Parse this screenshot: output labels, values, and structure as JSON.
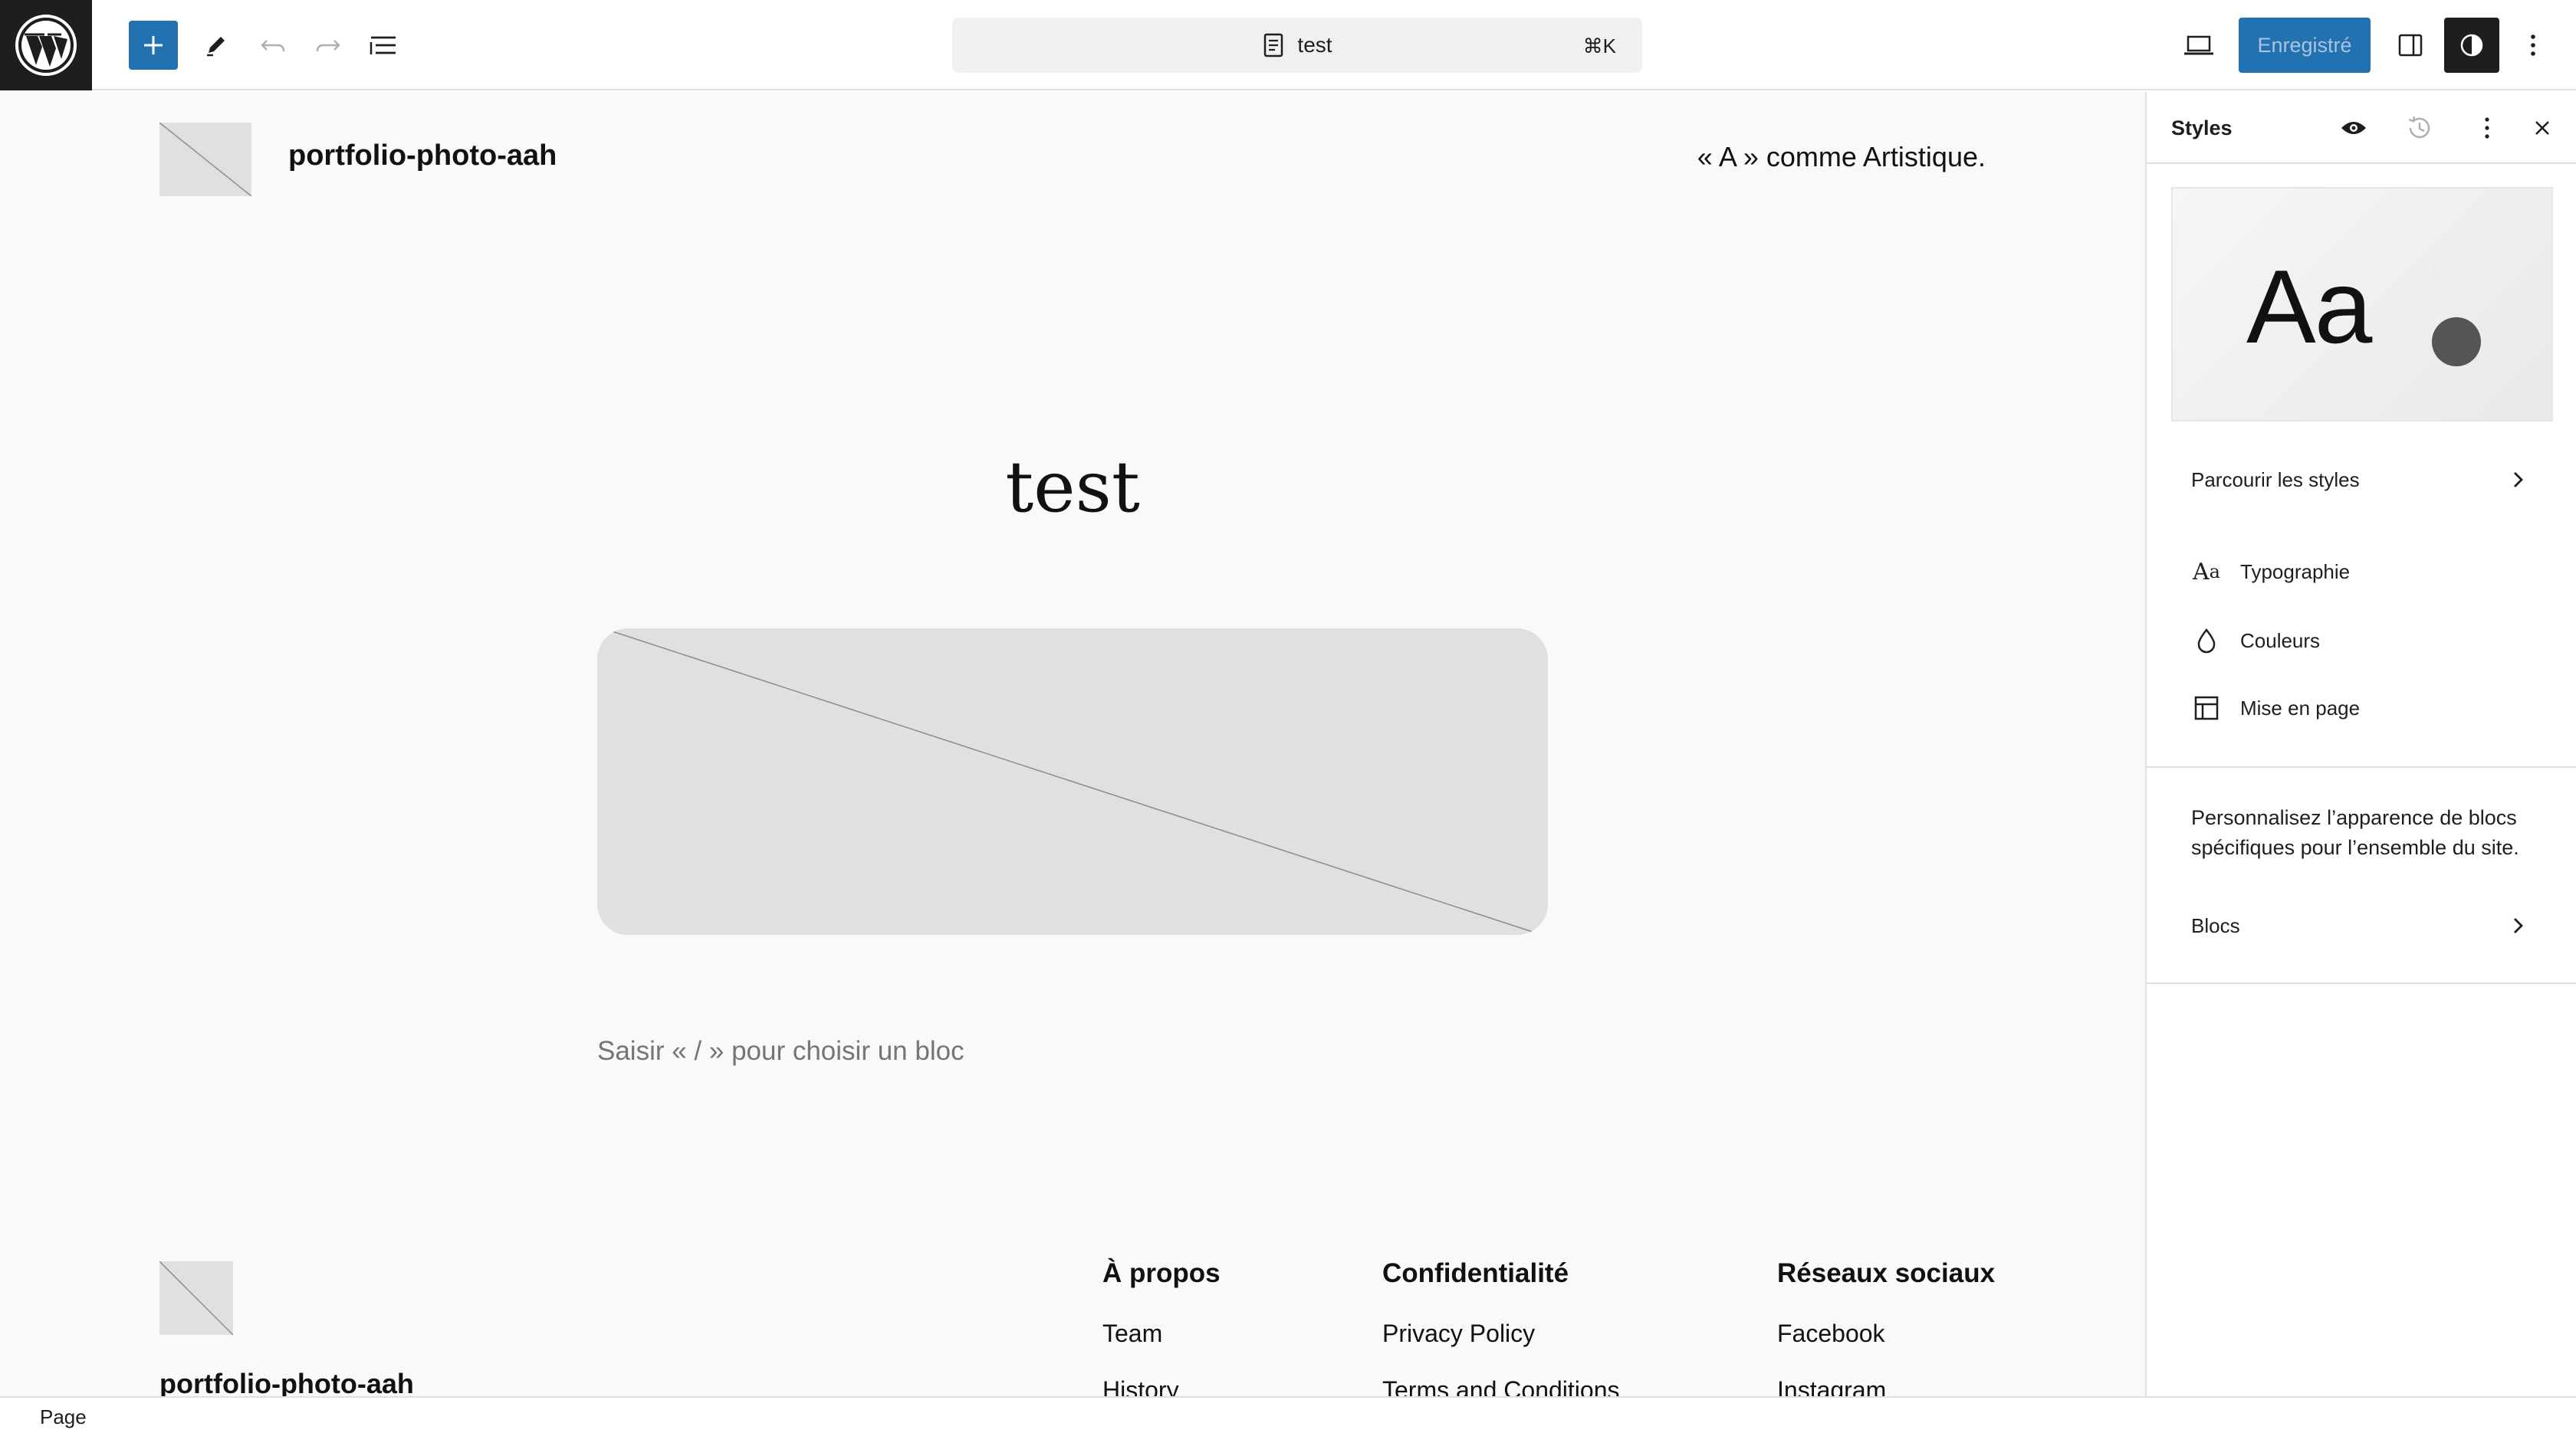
{
  "toolbar": {
    "logo_icon": "wordpress-logo-icon",
    "document_title": "test",
    "shortcut": "⌘K",
    "save_label": "Enregistré",
    "accent_color": "#2271b1"
  },
  "site": {
    "title": "portfolio-photo-aah",
    "tagline": "« A » comme Artistique."
  },
  "content": {
    "page_title": "test",
    "block_placeholder": "Saisir « / » pour choisir un bloc"
  },
  "footer": {
    "site_title": "portfolio-photo-aah",
    "columns": [
      {
        "heading": "À propos",
        "links": [
          "Team",
          "History"
        ]
      },
      {
        "heading": "Confidentialité",
        "links": [
          "Privacy Policy",
          "Terms and Conditions"
        ]
      },
      {
        "heading": "Réseaux sociaux",
        "links": [
          "Facebook",
          "Instagram"
        ]
      }
    ]
  },
  "statusbar": {
    "breadcrumb": "Page"
  },
  "sidebar": {
    "title": "Styles",
    "preview_text": "Aa",
    "browse_styles": "Parcourir les styles",
    "items": [
      {
        "label": "Typographie",
        "icon": "typography-icon"
      },
      {
        "label": "Couleurs",
        "icon": "color-drop-icon"
      },
      {
        "label": "Mise en page",
        "icon": "layout-icon"
      }
    ],
    "blocks_description": "Personnalisez l’apparence de blocs spécifiques pour l’ensemble du site.",
    "blocks_label": "Blocs"
  }
}
